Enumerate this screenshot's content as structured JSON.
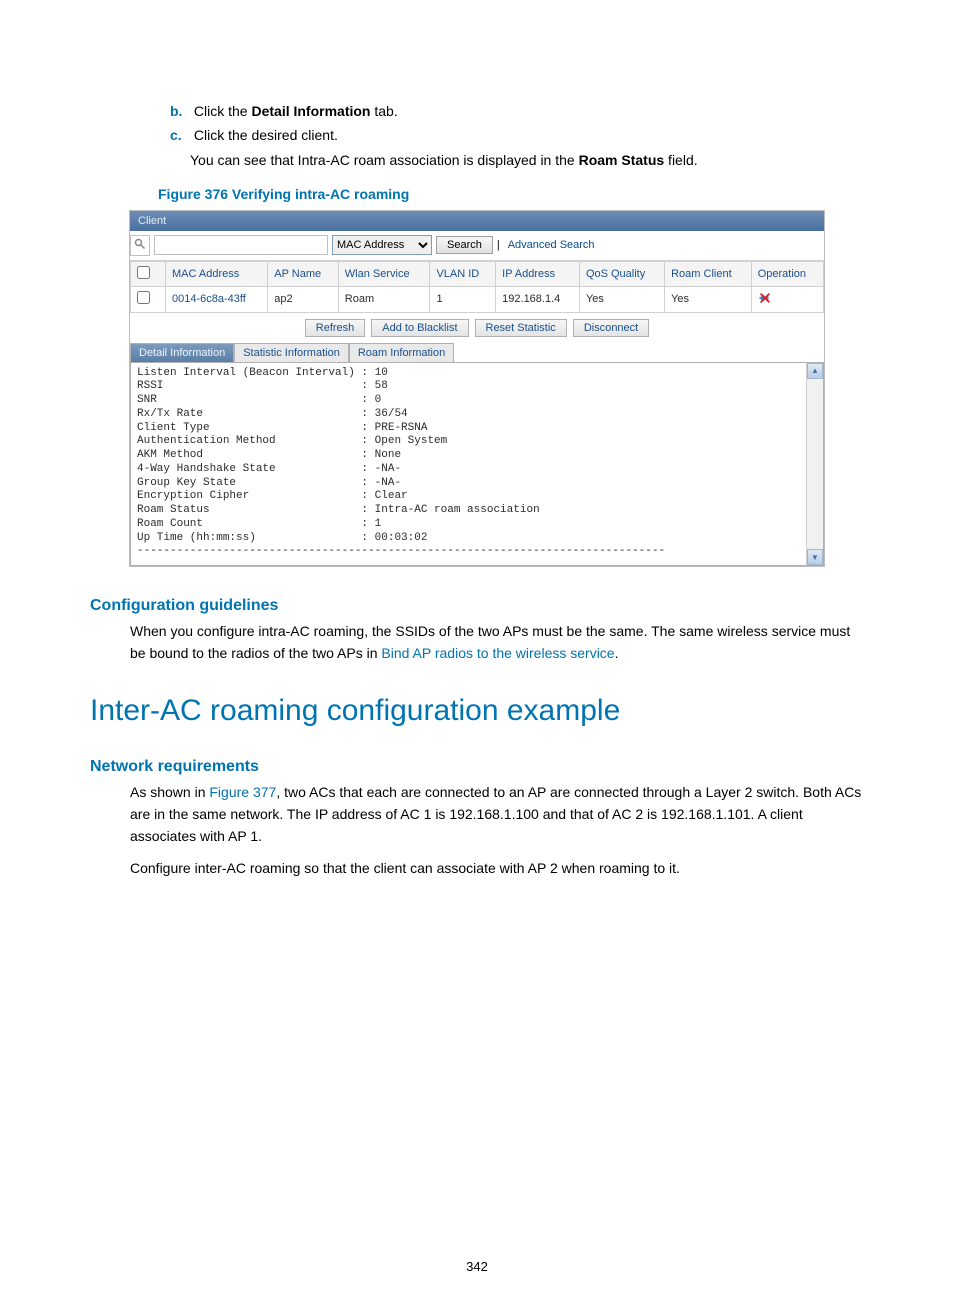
{
  "steps": {
    "b": {
      "letter": "b.",
      "prefix": "Click the ",
      "bold": "Detail Information",
      "suffix": " tab."
    },
    "c": {
      "letter": "c.",
      "text": "Click the desired client."
    }
  },
  "note": {
    "prefix": "You can see that Intra-AC roam association is displayed in the ",
    "bold": "Roam Status",
    "suffix": " field."
  },
  "figure_caption": "Figure 376 Verifying intra-AC roaming",
  "screenshot": {
    "titlebar": "Client",
    "search": {
      "field_value": "",
      "dropdown": "MAC Address",
      "button": "Search",
      "advanced": "Advanced Search"
    },
    "table": {
      "headers": {
        "mac": "MAC Address",
        "ap": "AP Name",
        "wlan": "Wlan Service",
        "vlan": "VLAN ID",
        "ip": "IP Address",
        "qos": "QoS Quality",
        "roam": "Roam Client",
        "op": "Operation"
      },
      "row": {
        "mac": "0014-6c8a-43ff",
        "ap": "ap2",
        "wlan": "Roam",
        "vlan": "1",
        "ip": "192.168.1.4",
        "qos": "Yes",
        "roam": "Yes"
      }
    },
    "actions": {
      "refresh": "Refresh",
      "blacklist": "Add to Blacklist",
      "reset": "Reset Statistic",
      "disconnect": "Disconnect"
    },
    "tabs": {
      "detail": "Detail Information",
      "stat": "Statistic Information",
      "roam": "Roam Information"
    },
    "detail_text": "Listen Interval (Beacon Interval) : 10\nRSSI                              : 58\nSNR                               : 0\nRx/Tx Rate                        : 36/54\nClient Type                       : PRE-RSNA\nAuthentication Method             : Open System\nAKM Method                        : None\n4-Way Handshake State             : -NA-\nGroup Key State                   : -NA-\nEncryption Cipher                 : Clear\nRoam Status                       : Intra-AC roam association\nRoam Count                        : 1\nUp Time (hh:mm:ss)                : 00:03:02\n--------------------------------------------------------------------------------"
  },
  "config_guidelines": {
    "heading": "Configuration guidelines",
    "text_prefix": "When you configure intra-AC roaming, the SSIDs of the two APs must be the same. The same wireless service must be bound to the radios of the two APs in ",
    "link": "Bind AP radios to the wireless service",
    "text_suffix": "."
  },
  "inter_ac": {
    "heading": "Inter-AC roaming configuration example",
    "subheading": "Network requirements",
    "para1_prefix": "As shown in ",
    "para1_link": "Figure 377",
    "para1_suffix": ", two ACs that each are connected to an AP are connected through a Layer 2 switch. Both ACs are in the same network. The IP address of AC 1 is 192.168.1.100 and that of AC 2 is 192.168.1.101. A client associates with AP 1.",
    "para2": "Configure inter-AC roaming so that the client can associate with AP 2 when roaming to it."
  },
  "page_number": "342"
}
